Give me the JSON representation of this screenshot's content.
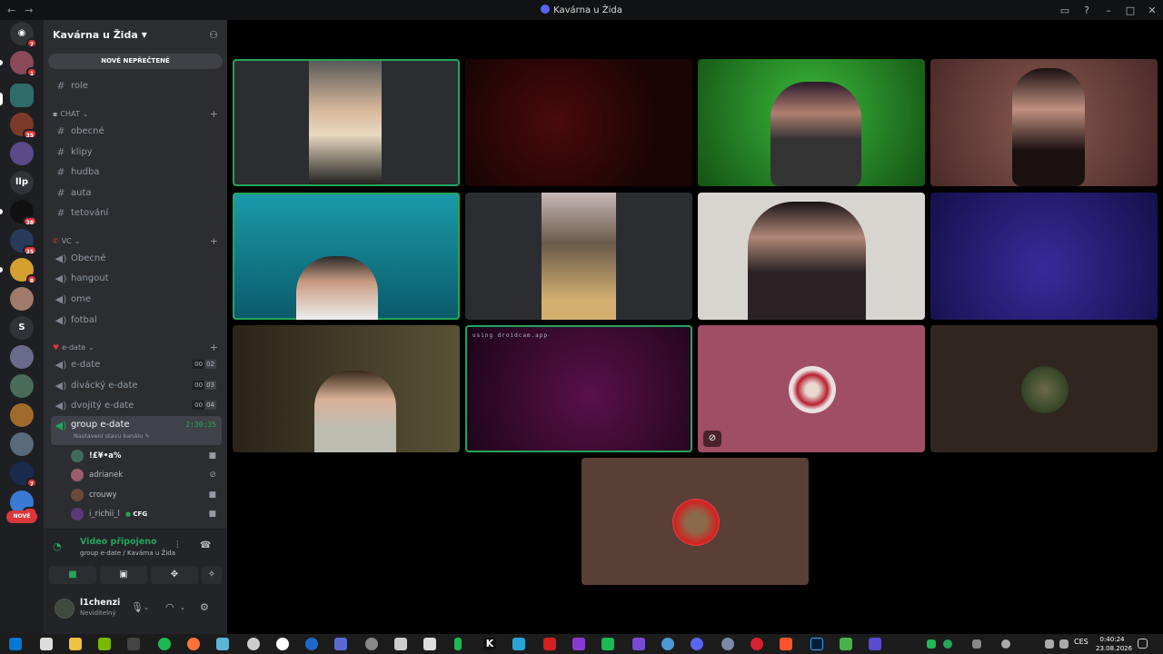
{
  "window": {
    "title": "Kavárna u Žida"
  },
  "rail": {
    "badges": [
      "7",
      "1",
      "35",
      "38",
      "35",
      "8",
      "7",
      "64"
    ],
    "text_servers": [
      "llp",
      "S"
    ],
    "new_label": "NOVÉ"
  },
  "server": {
    "name": "Kavárna u Žida",
    "new_unread": "NOVÉ NEPŘEČTENÉ"
  },
  "channels": {
    "top": {
      "name": "role"
    },
    "chat": {
      "category": "CHAT",
      "items": [
        "obecné",
        "klipy",
        "hudba",
        "auta",
        "tetování"
      ]
    },
    "vc": {
      "category": "VC",
      "items": [
        "Obecné",
        "hangout",
        "ome",
        "fotbal"
      ]
    },
    "edate": {
      "category": "e-date",
      "items": [
        {
          "name": "e-date",
          "a": "00",
          "b": "02"
        },
        {
          "name": "divácký e-date",
          "a": "00",
          "b": "03"
        },
        {
          "name": "dvojitý e-date",
          "a": "00",
          "b": "04"
        }
      ],
      "active": {
        "name": "group e-date",
        "timer": "2:30:35",
        "status": "Nastavení stavu kanálu"
      }
    }
  },
  "members": [
    {
      "name": "!£¥•a%",
      "color": "#3f6b5a"
    },
    {
      "name": "adrianek",
      "color": "#9b5c6e"
    },
    {
      "name": "crouwy",
      "color": "#6b4a3a"
    },
    {
      "name": "i_richii_l",
      "tag": "CFG",
      "color": "#5a3a7a"
    }
  ],
  "voice": {
    "status": "Video připojeno",
    "location": "group e-date / Kavárna u Žida"
  },
  "user": {
    "name": "l1chenzi",
    "status": "Neviditelný"
  },
  "tiles": {
    "droidcam_label": "using droidcam.app"
  },
  "taskbar": {
    "lang": "CES",
    "time": "0:40:24",
    "date": "23.08.2026"
  }
}
